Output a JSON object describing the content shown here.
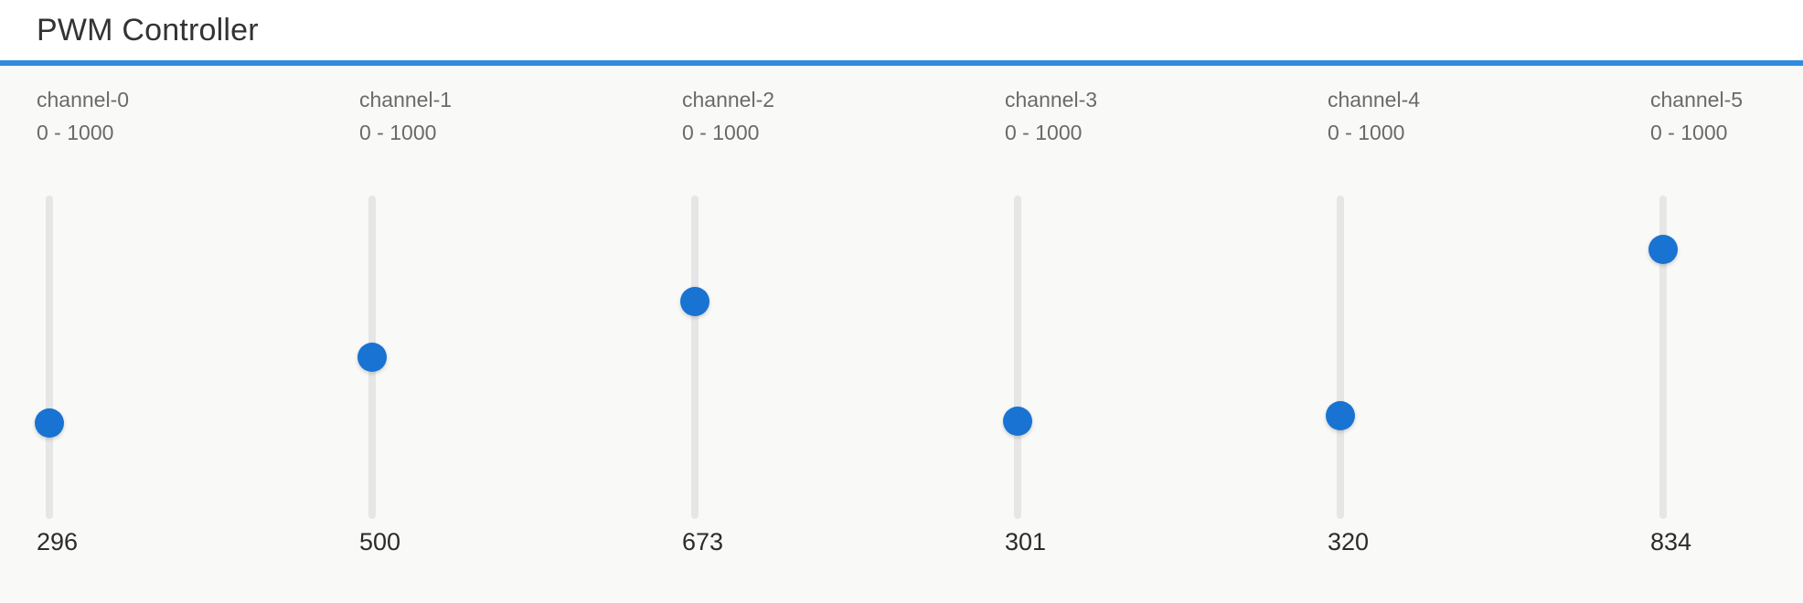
{
  "app": {
    "title": "PWM Controller"
  },
  "colors": {
    "accent": "#2f8be0",
    "thumb": "#1873d3",
    "track": "#e6e6e6",
    "background": "#f9f9f8"
  },
  "channels": [
    {
      "name": "channel-0",
      "range": "0 - 1000",
      "min": 0,
      "max": 1000,
      "value": 296,
      "value_label": "296"
    },
    {
      "name": "channel-1",
      "range": "0 - 1000",
      "min": 0,
      "max": 1000,
      "value": 500,
      "value_label": "500"
    },
    {
      "name": "channel-2",
      "range": "0 - 1000",
      "min": 0,
      "max": 1000,
      "value": 673,
      "value_label": "673"
    },
    {
      "name": "channel-3",
      "range": "0 - 1000",
      "min": 0,
      "max": 1000,
      "value": 301,
      "value_label": "301"
    },
    {
      "name": "channel-4",
      "range": "0 - 1000",
      "min": 0,
      "max": 1000,
      "value": 320,
      "value_label": "320"
    },
    {
      "name": "channel-5",
      "range": "0 - 1000",
      "min": 0,
      "max": 1000,
      "value": 834,
      "value_label": "834"
    }
  ]
}
